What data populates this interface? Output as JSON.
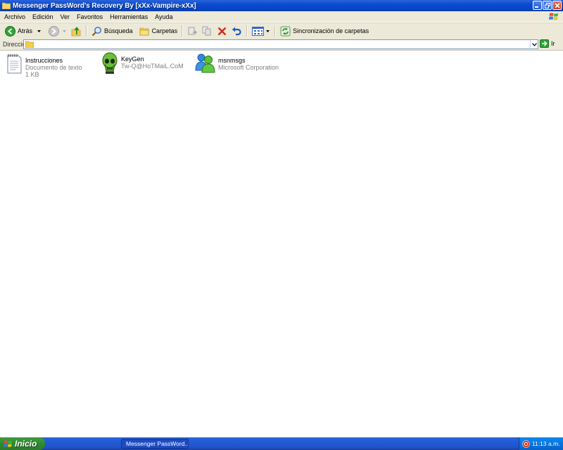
{
  "window": {
    "title": "Messenger PassWord's Recovery By [xXx-Vampire-xXx]"
  },
  "menu": [
    "Archivo",
    "Edición",
    "Ver",
    "Favoritos",
    "Herramientas",
    "Ayuda"
  ],
  "toolbar": {
    "back_label": "Atrás",
    "search_label": "Búsqueda",
    "folders_label": "Carpetas",
    "sync_label": "Sincronización de carpetas"
  },
  "address": {
    "label": "Dirección",
    "value": "",
    "go_label": "Ir"
  },
  "files": [
    {
      "name": "Instrucciones",
      "line2": "Documento de texto",
      "line3": "1 KB",
      "icon": "text-document-icon"
    },
    {
      "name": "KeyGen",
      "line2": "Tw-Q@HoTMaiL.CoM",
      "line3": "",
      "icon": "skull-icon"
    },
    {
      "name": "msnmsgs",
      "line2": "Microsoft Corporation",
      "line3": "",
      "icon": "msn-messenger-icon"
    }
  ],
  "taskbar": {
    "start_label": "Inicio",
    "task_label": "Messenger PassWord...",
    "clock": "11:13 a.m."
  }
}
